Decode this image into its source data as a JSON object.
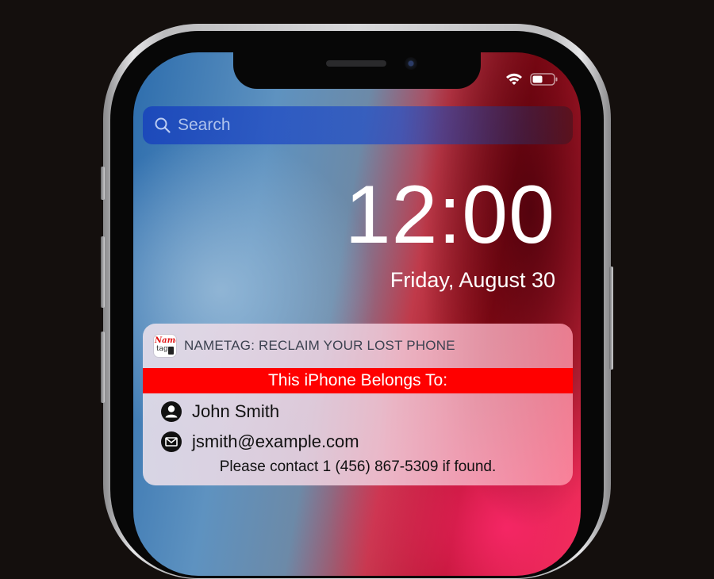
{
  "status_bar": {
    "wifi_icon": "wifi-icon",
    "battery_icon": "battery-icon"
  },
  "search": {
    "placeholder": "Search",
    "icon": "search-icon"
  },
  "lock_screen": {
    "time": "12:00",
    "date": "Friday, August 30"
  },
  "notification": {
    "app_icon": "nametag-app-icon",
    "app_icon_text_top": "Name",
    "app_icon_text_bottom": "tag",
    "title": "NAMETAG: RECLAIM YOUR LOST PHONE",
    "banner": "This iPhone Belongs To:",
    "owner_name": "John Smith",
    "owner_email": "jsmith@example.com",
    "message": "Please contact 1 (456) 867-5309 if found.",
    "banner_color": "#ff0000"
  }
}
